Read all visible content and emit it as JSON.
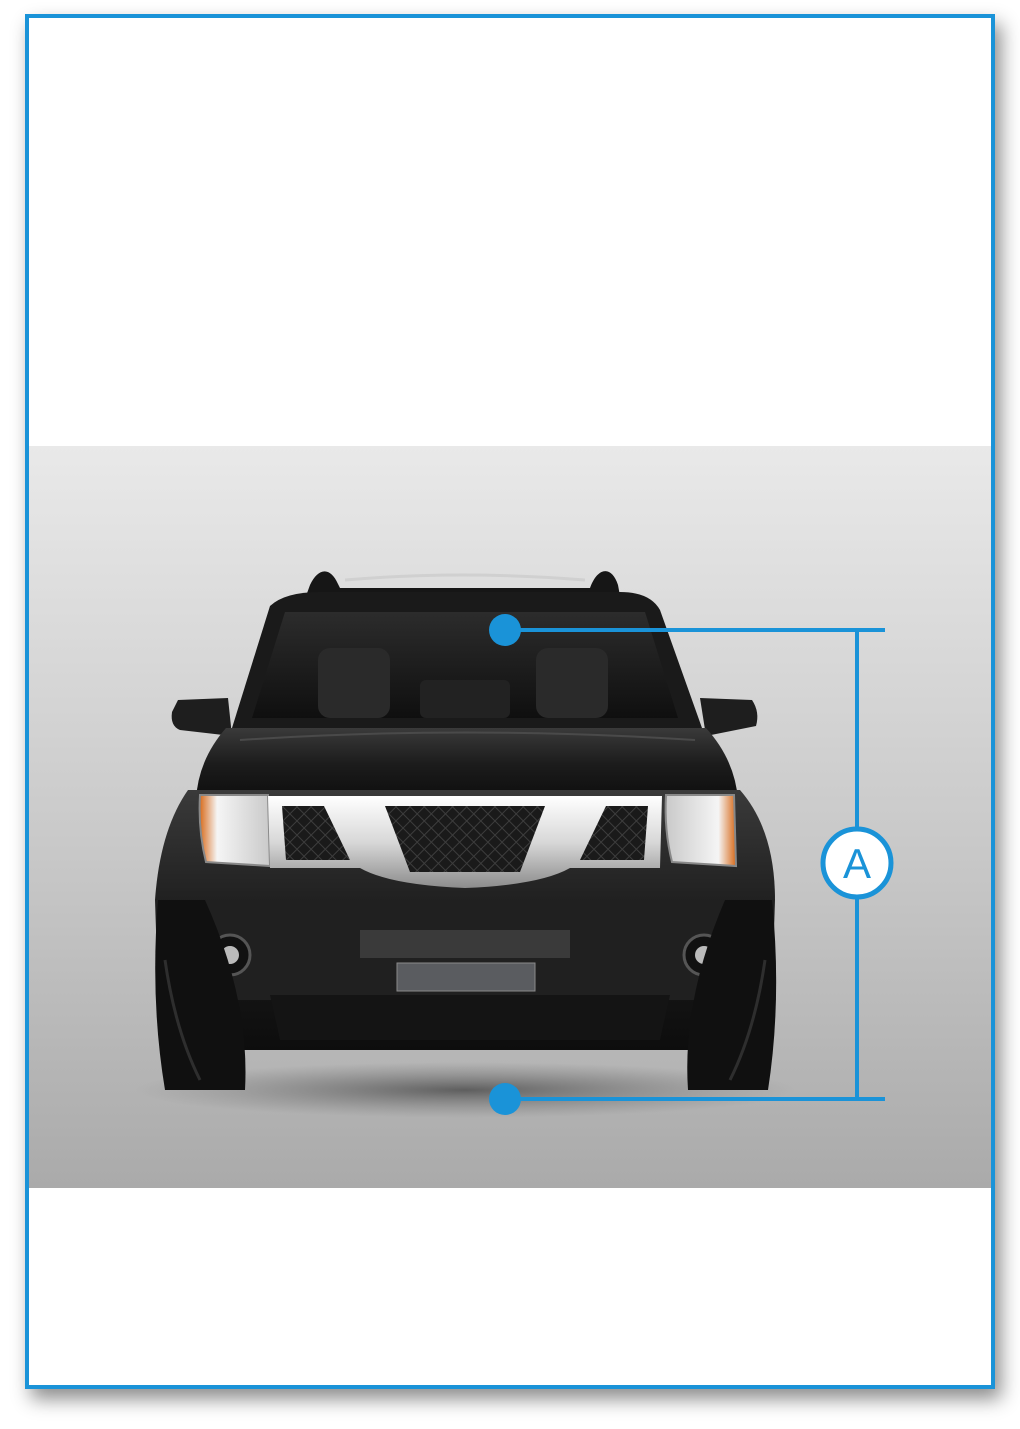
{
  "colors": {
    "accent": "#1a93d8",
    "frame_border": "#1a93d8",
    "vehicle_body": "#1b1b1b",
    "background_top": "#e9e9e9",
    "background_bottom": "#aaaaaa"
  },
  "vehicle": {
    "type": "suv",
    "view": "front"
  },
  "dimension_marker": {
    "label": "A",
    "icon": "dimension-bracket-icon"
  }
}
